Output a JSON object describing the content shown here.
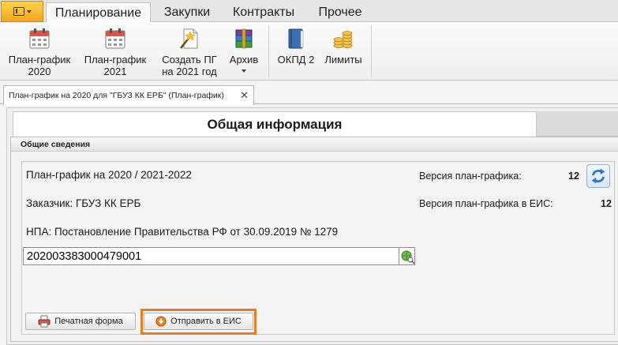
{
  "ribbon": {
    "tabs": [
      {
        "label": "Планирование",
        "active": true
      },
      {
        "label": "Закупки",
        "active": false
      },
      {
        "label": "Контракты",
        "active": false
      },
      {
        "label": "Прочее",
        "active": false
      }
    ],
    "buttons": {
      "plan2020": {
        "line1": "План-график",
        "line2": "2020",
        "icon": "calendar-icon"
      },
      "plan2021": {
        "line1": "План-график",
        "line2": "2021",
        "icon": "calendar-icon"
      },
      "create_pg": {
        "line1": "Создать ПГ",
        "line2": "на 2021 год",
        "icon": "magic-wand-icon"
      },
      "archive": {
        "line1": "Архив",
        "icon": "archive-icon"
      },
      "okpd2": {
        "line1": "ОКПД 2",
        "icon": "book-icon"
      },
      "limits": {
        "line1": "Лимиты",
        "icon": "coins-icon"
      }
    }
  },
  "document_tab": {
    "title": "План-график на 2020 для \"ГБУЗ КК ЕРБ\" (План-график)",
    "close": "✕"
  },
  "form": {
    "section_title": "Общая информация",
    "group_title": "Общие сведения",
    "plan_title": "План-график на 2020 / 2021-2022",
    "customer": "Заказчик: ГБУЗ КК ЕРБ",
    "npa": "НПА: Постановление Правительства РФ от 30.09.2019 № 1279",
    "version_label": "Версия план-графика:",
    "version_value": "12",
    "eis_version_label": "Версия план-графика в ЕИС:",
    "eis_version_value": "12",
    "reestr_number": "202003383000479001",
    "print_button": "Печатная форма",
    "send_button": "Отправить в ЕИС"
  },
  "colors": {
    "highlight": "#f07a1f",
    "app_button": "#f5b82e"
  }
}
